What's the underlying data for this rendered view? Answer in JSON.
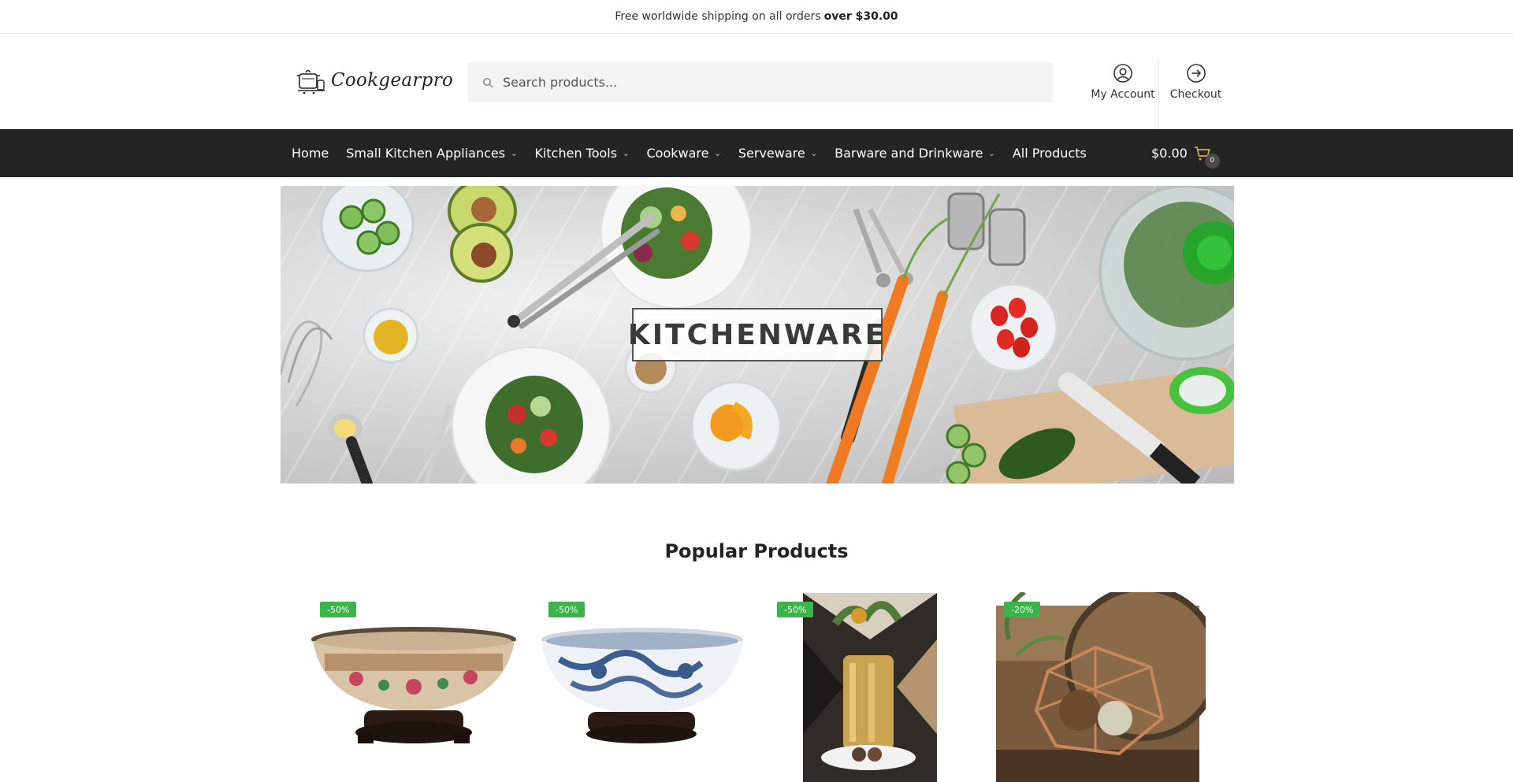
{
  "topbar": {
    "text": "Free worldwide shipping on all orders",
    "highlight": "over $30.00"
  },
  "header": {
    "logo_text": "Cookgearpro",
    "search_placeholder": "Search products...",
    "account_label": "My Account",
    "checkout_label": "Checkout"
  },
  "nav": {
    "items": [
      {
        "label": "Home",
        "has_dropdown": false
      },
      {
        "label": "Small Kitchen Appliances",
        "has_dropdown": true
      },
      {
        "label": "Kitchen Tools",
        "has_dropdown": true
      },
      {
        "label": "Cookware",
        "has_dropdown": true
      },
      {
        "label": "Serveware",
        "has_dropdown": true
      },
      {
        "label": "Barware and Drinkware",
        "has_dropdown": true
      },
      {
        "label": "All Products",
        "has_dropdown": false
      }
    ],
    "cart_total": "$0.00",
    "cart_count": "0"
  },
  "hero": {
    "label": "KITCHENWARE"
  },
  "popular": {
    "title": "Popular Products",
    "products": [
      {
        "badge": "-50%",
        "image": "famille-rose-bowl"
      },
      {
        "badge": "-50%",
        "image": "blue-white-bowl"
      },
      {
        "badge": "-50%",
        "image": "gold-vase"
      },
      {
        "badge": "-20%",
        "image": "copper-wire-basket"
      }
    ]
  },
  "colors": {
    "nav_bg": "#242424",
    "badge": "#3bb54a",
    "cart_icon": "#e8a33d"
  }
}
